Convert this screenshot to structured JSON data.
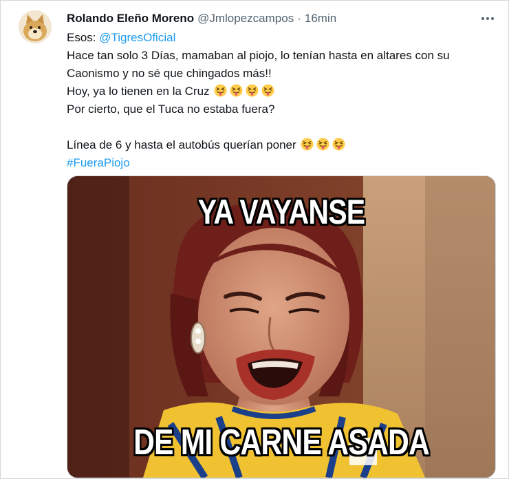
{
  "author": {
    "display_name": "Rolando Eleño Moreno",
    "handle": "@Jmlopezcampos",
    "separator": "·",
    "time": "16min"
  },
  "tweet": {
    "line1_prefix": "Esos: ",
    "mention": "@TigresOficial",
    "line2": "Hace tan solo 3 Días, mamaban al piojo, lo tenían hasta en altares con su",
    "line3": "Caonismo y no sé que chingados más!!",
    "line4": "Hoy, ya lo tienen en la Cruz",
    "line5": "Por cierto, que el Tuca no estaba fuera?",
    "line6": "Línea de 6 y hasta el autobús querían poner",
    "hashtag": "#FueraPiojo"
  },
  "media": {
    "caption_top": "YA VAYANSE",
    "caption_bottom": "DE MI CARNE ASADA"
  },
  "icons": {
    "avatar": "doge-avatar",
    "more": "more-options-icon",
    "emoji": "squinting-face-with-tongue-emoji"
  },
  "colors": {
    "link": "#1d9bf0",
    "text": "#0f1419",
    "secondary_text": "#536471",
    "border": "#cfd9de"
  }
}
